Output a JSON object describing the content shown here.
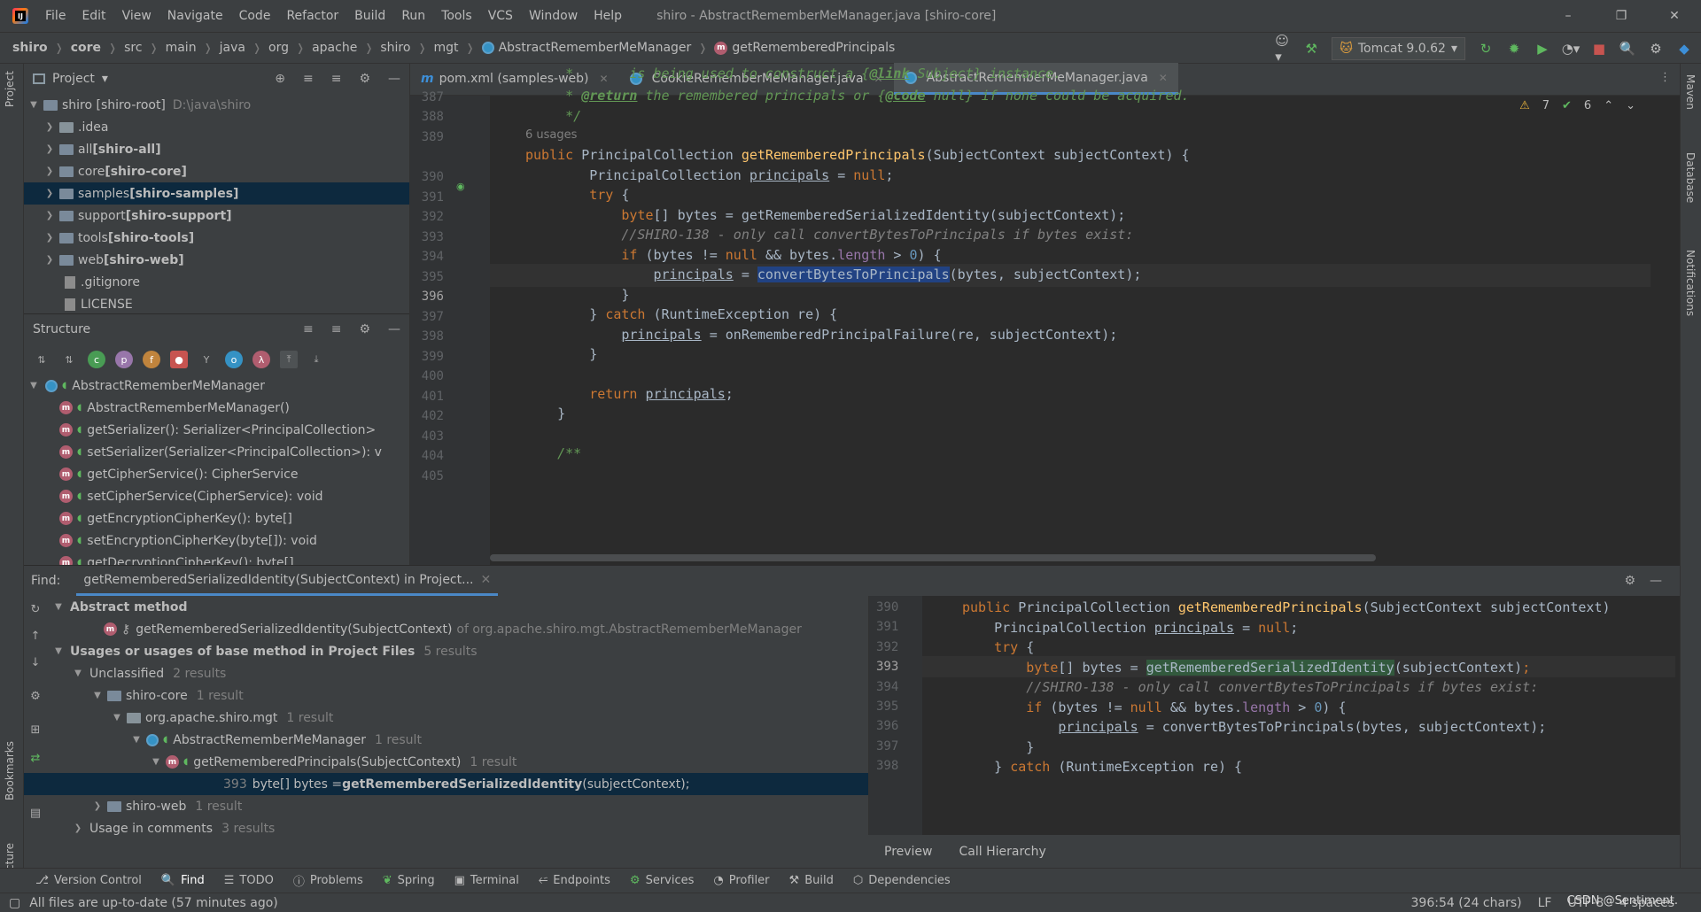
{
  "menubar": {
    "items": [
      "File",
      "Edit",
      "View",
      "Navigate",
      "Code",
      "Refactor",
      "Build",
      "Run",
      "Tools",
      "VCS",
      "Window",
      "Help"
    ],
    "title": "shiro - AbstractRememberMeManager.java [shiro-core]"
  },
  "breadcrumb": [
    "shiro",
    "core",
    "src",
    "main",
    "java",
    "org",
    "apache",
    "shiro",
    "mgt",
    "AbstractRememberMeManager",
    "getRememberedPrincipals"
  ],
  "run_config": "Tomcat 9.0.62",
  "project": {
    "header": "Project",
    "root_label": "shiro [shiro-root]",
    "root_path": "D:\\java\\shiro",
    "items": [
      {
        "label": ".idea",
        "bold": "",
        "type": "folder"
      },
      {
        "label": "all ",
        "bold": "[shiro-all]",
        "type": "module"
      },
      {
        "label": "core ",
        "bold": "[shiro-core]",
        "type": "module"
      },
      {
        "label": "samples ",
        "bold": "[shiro-samples]",
        "type": "module"
      },
      {
        "label": "support ",
        "bold": "[shiro-support]",
        "type": "module"
      },
      {
        "label": "tools ",
        "bold": "[shiro-tools]",
        "type": "module"
      },
      {
        "label": "web ",
        "bold": "[shiro-web]",
        "type": "module"
      },
      {
        "label": ".gitignore",
        "bold": "",
        "type": "file"
      },
      {
        "label": "LICENSE",
        "bold": "",
        "type": "file"
      }
    ]
  },
  "structure": {
    "header": "Structure",
    "class": "AbstractRememberMeManager",
    "members": [
      "AbstractRememberMeManager()",
      "getSerializer(): Serializer<PrincipalCollection>",
      "setSerializer(Serializer<PrincipalCollection>): v",
      "getCipherService(): CipherService",
      "setCipherService(CipherService): void",
      "getEncryptionCipherKey(): byte[]",
      "setEncryptionCipherKey(byte[]): void",
      "getDecryptionCipherKey(): byte[]"
    ]
  },
  "tabs": [
    {
      "label": "pom.xml (samples-web)"
    },
    {
      "label": "CookieRememberMeManager.java"
    },
    {
      "label": "AbstractRememberMeManager.java"
    }
  ],
  "inspections": {
    "warnings": "7",
    "ok": "6"
  },
  "editor": {
    "usages": "6 usages",
    "lines": [
      "387",
      "388",
      "389",
      "390",
      "391",
      "392",
      "393",
      "394",
      "395",
      "396",
      "397",
      "398",
      "399",
      "400",
      "401",
      "402",
      "403",
      "404",
      "405"
    ]
  },
  "find": {
    "label": "Find:",
    "tab": "getRememberedSerializedIdentity(SubjectContext) in Project...",
    "abstract_method": "Abstract method",
    "method_sig": "getRememberedSerializedIdentity(SubjectContext)",
    "method_of": "of org.apache.shiro.mgt.AbstractRememberMeManager",
    "usages_title": "Usages or usages of base method in Project Files",
    "usages_count": "5 results",
    "unclassified": "Unclassified",
    "unclassified_count": "2 results",
    "shiro_core": "shiro-core",
    "shiro_core_count": "1 result",
    "pkg": "org.apache.shiro.mgt",
    "pkg_count": "1 result",
    "cls": "AbstractRememberMeManager",
    "cls_count": "1 result",
    "method": "getRememberedPrincipals(SubjectContext)",
    "method_count": "1 result",
    "hit_line": "393",
    "hit_pre": "byte[] bytes = ",
    "hit_bold": "getRememberedSerializedIdentity",
    "hit_post": "(subjectContext);",
    "shiro_web": "shiro-web",
    "shiro_web_count": "1 result",
    "comments": "Usage in comments",
    "comments_count": "3 results",
    "preview_lines": [
      "390",
      "391",
      "392",
      "393",
      "394",
      "395",
      "396",
      "397",
      "398"
    ],
    "preview_tab": "Preview",
    "callhier_tab": "Call Hierarchy"
  },
  "toolwindows": [
    "Version Control",
    "Find",
    "TODO",
    "Problems",
    "Spring",
    "Terminal",
    "Endpoints",
    "Services",
    "Profiler",
    "Build",
    "Dependencies"
  ],
  "status": {
    "message": "All files are up-to-date (57 minutes ago)",
    "position": "396:54 (24 chars)",
    "line_sep": "LF",
    "encoding": "UTF-8",
    "indent": "4 spaces",
    "watermark": "CSDN @Sentiment."
  },
  "side_labels": {
    "project": "Project",
    "bookmarks": "Bookmarks",
    "structure": "Structure",
    "maven": "Maven",
    "database": "Database",
    "notifications": "Notifications"
  }
}
